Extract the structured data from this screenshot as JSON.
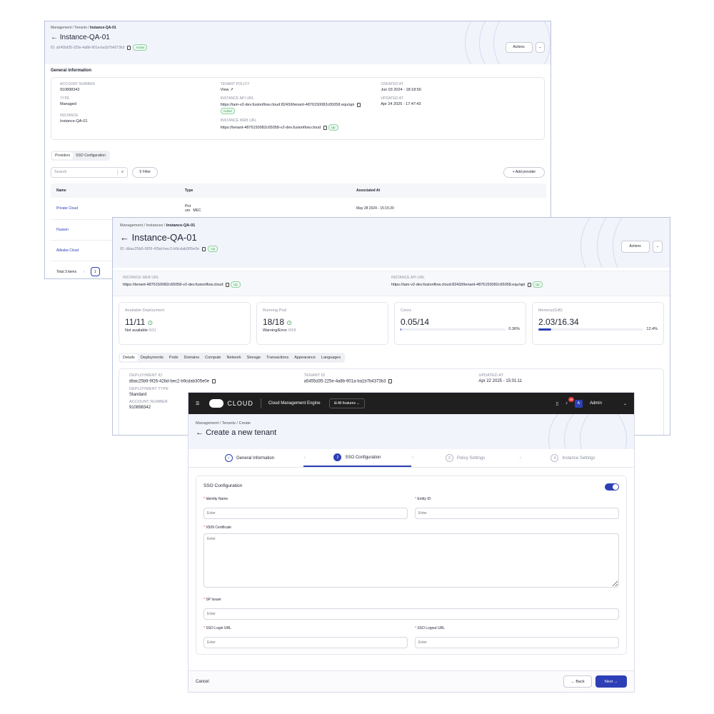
{
  "p1": {
    "breadcrumb": {
      "a": "Management",
      "b": "Tenants",
      "c": "Instance-QA-01"
    },
    "title": "Instance-QA-01",
    "id_text": "ID: a5455d35-225e-4a8b-901a-ba1b7b4373b3",
    "status": "Active",
    "actions": "Actions",
    "section": "General information",
    "info": {
      "account_number_label": "ACCOUNT NUMBER",
      "account_number": "910898342",
      "type_label": "TYPE",
      "type": "Managed",
      "instance_label": "INSTANCE",
      "instance": "Instance-QA-01",
      "tenant_policy_label": "TENANT POLICY",
      "tenant_policy": "View",
      "api_url_label": "INSTANCE API URL",
      "api_url": "https://iam-v2-dev.fusionflow.cloud:8243/t/tenant-4876150082c65058.equ/api",
      "api_status": "Active",
      "web_url_label": "INSTANCE WEB URL",
      "web_url": "https://tenant-4876150082c65058-v2-dev.fusionflow.cloud",
      "web_status": "Up",
      "created_label": "CREATED AT",
      "created": "Jun 03 2024 - 18:18:56",
      "updated_label": "UPDATED AT",
      "updated": "Apr 24 2025 - 17:47:43"
    },
    "tabs": [
      "Providers",
      "SSO Configuration"
    ],
    "search_placeholder": "Search",
    "filter": "Filter",
    "add_provider": "+ Add provider",
    "columns": [
      "Name",
      "Type",
      "Associated At"
    ],
    "rows": [
      {
        "name": "Private Cloud",
        "type_a": "Pict ure",
        "type_b": "MEC",
        "date": "May 28 2024 - 15:15:20"
      },
      {
        "name": "Huawei"
      },
      {
        "name": "Alibaba Cloud"
      }
    ],
    "total": "Total 3 items",
    "page": "1"
  },
  "p2": {
    "breadcrumb": {
      "a": "Management",
      "b": "Instances",
      "c": "Instance-QA-01"
    },
    "title": "Instance-QA-01",
    "id_text": "ID: dbac25b9-9f26-42bd-bec2-b9cdab305e0e",
    "status": "Up",
    "actions": "Actions",
    "web_label": "INSTANCE WEB URL",
    "web_url": "https://tenant-4876150082c65058-v2-dev.fusionflow.cloud",
    "web_status": "Up",
    "api_label": "INSTANCE API URL",
    "api_url": "https://iam-v2-dev.fusionflow.cloud:8243/t/tenant-4876150082c65058.equ/api",
    "api_status": "Up",
    "stats": {
      "dep_label": "Available Deployment",
      "dep_value": "11/11",
      "dep_sub_a": "Not available",
      "dep_sub_b": "0/11",
      "pod_label": "Running Pod",
      "pod_value": "18/18",
      "pod_sub_a": "Warning/Error",
      "pod_sub_b": "0/18",
      "cores_label": "Cores",
      "cores_value": "0.05/14",
      "cores_pct": "0.36%",
      "cores_fill": 0.0036,
      "mem_label": "Memory(GiB)",
      "mem_value": "2.03/16.34",
      "mem_pct": "12.4%",
      "mem_fill": 0.124
    },
    "tabs": [
      "Details",
      "Deployments",
      "Pods",
      "Domains",
      "Compute",
      "Network",
      "Storage",
      "Transactions",
      "Appearance",
      "Languages"
    ],
    "detail": {
      "dep_id_label": "DEPLOYMENT ID",
      "dep_id": "dbac25b9-9f26-42bd-bec2-b9cdab305e0e",
      "dep_type_label": "DEPLOYMENT TYPE",
      "dep_type": "Standard",
      "acct_label": "ACCOUNT NUMBER",
      "acct": "910898342",
      "tenant_label": "TENANT ID",
      "tenant": "a5455d35-225e-4a8b-901a-ba1b7b4373b3",
      "updated_label": "UPDATED AT",
      "updated": "Apr 22 2025 - 15:01:11"
    }
  },
  "p3": {
    "brand": "CLOUD",
    "app_name": "Cloud Management Engine",
    "all_features": "All features",
    "notif_count": "99",
    "avatar": "A",
    "user": "Admin",
    "breadcrumb": {
      "a": "Management",
      "b": "Tenants",
      "c": "Create"
    },
    "title": "Create a new tenant",
    "steps": [
      {
        "num": "✓",
        "label": "General Information"
      },
      {
        "num": "2",
        "label": "SSO Configuration"
      },
      {
        "num": "3",
        "label": "Policy Settings"
      },
      {
        "num": "4",
        "label": "Instance Settings"
      }
    ],
    "form": {
      "title": "SSO Configuration",
      "identity_label": "Identity Name",
      "entity_label": "Entity ID",
      "cert_label": "X509 Certificate",
      "sp_label": "SP Issuer",
      "login_label": "SSO Login URL",
      "logout_label": "SSO Logout URL",
      "placeholder": "Enter"
    },
    "cancel": "Cancel",
    "back": "← Back",
    "next": "Next →"
  }
}
